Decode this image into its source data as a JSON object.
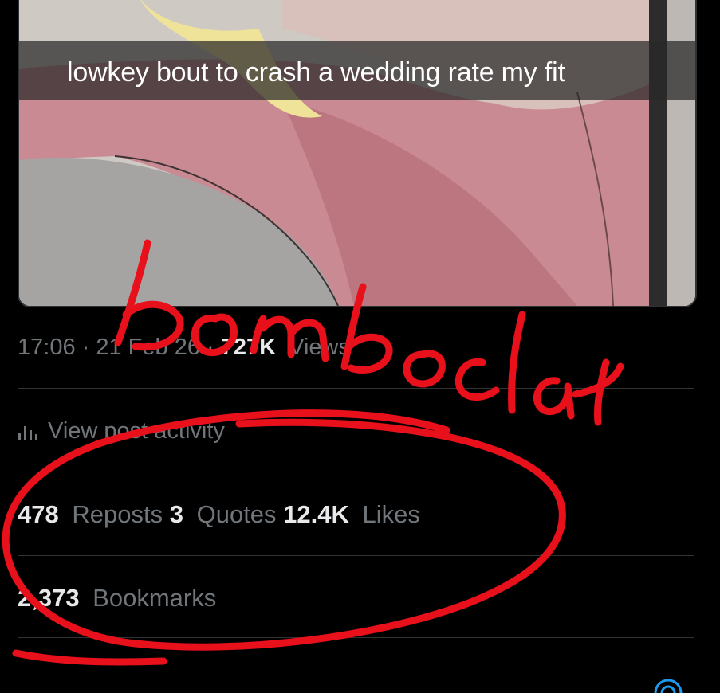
{
  "tweet": {
    "caption": "lowkey bout to crash a wedding rate my fit",
    "time": "17:06",
    "date": "21 Feb 26",
    "views_count": "727K",
    "views_label": "Views",
    "activity_label": "View post activity",
    "reposts_count": "478",
    "reposts_label": "Reposts",
    "quotes_count": "3",
    "quotes_label": "Quotes",
    "likes_count": "12.4K",
    "likes_label": "Likes",
    "bookmarks_count": "2,373",
    "bookmarks_label": "Bookmarks"
  },
  "annotation": {
    "handwritten_text": "bomboclat",
    "ink_color": "#e8101a"
  },
  "colors": {
    "background": "#000000",
    "primary_text": "#e7e9ea",
    "secondary_text": "#71767b",
    "divider": "#2f3336",
    "accent": "#1d9bf0"
  }
}
